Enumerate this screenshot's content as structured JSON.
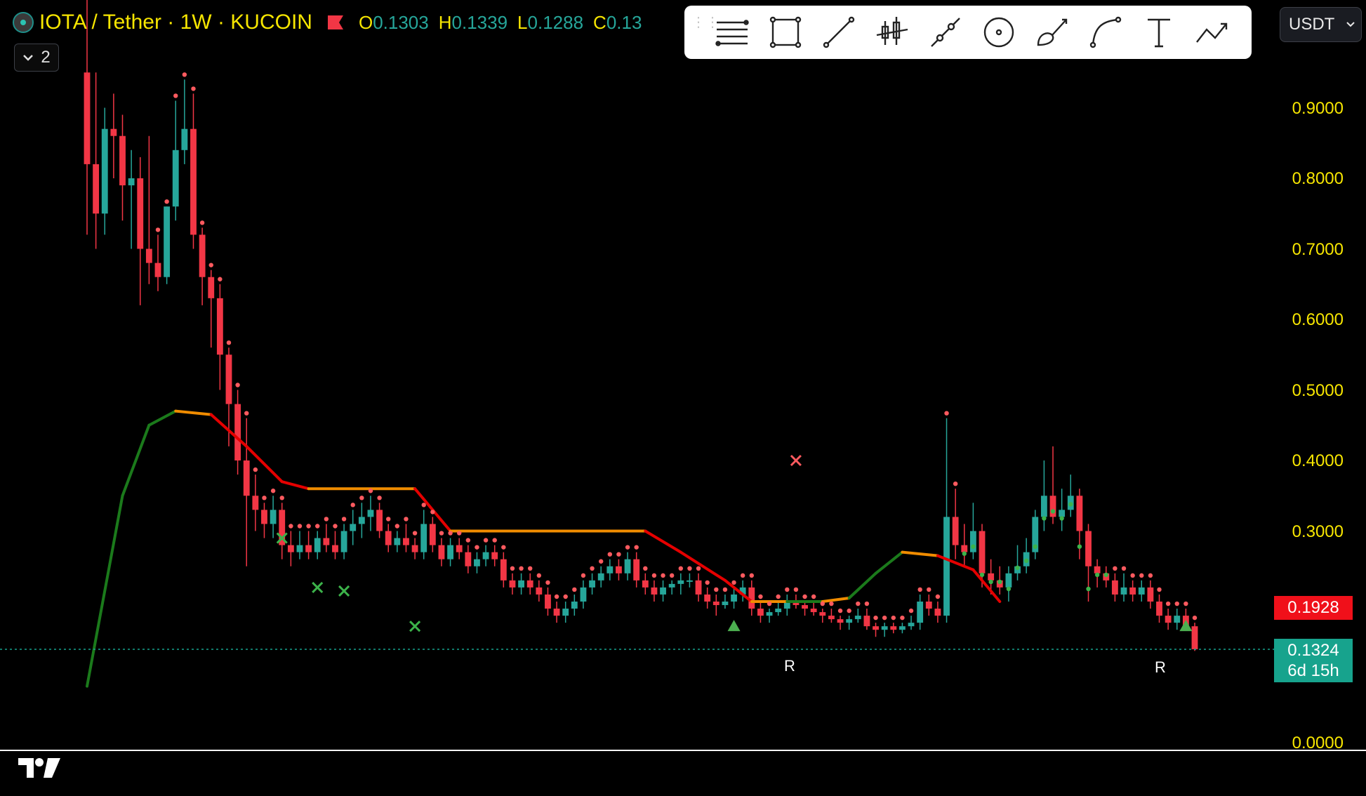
{
  "header": {
    "symbol_title": "IOTA / Tether · 1W · KUCOIN",
    "ohlc": [
      {
        "key": "O",
        "value": "0.1303"
      },
      {
        "key": "H",
        "value": "0.1339"
      },
      {
        "key": "L",
        "value": "0.1288"
      },
      {
        "key": "C",
        "value": "0.13"
      }
    ],
    "collapse_count": "2",
    "currency": "USDT"
  },
  "toolbar": {
    "tools": [
      "lines-menu-icon",
      "rectangle-icon",
      "trend-line-icon",
      "candles-icon",
      "segment-icon",
      "circle-icon",
      "brush-icon",
      "curve-icon",
      "text-icon",
      "path-icon"
    ]
  },
  "colors": {
    "up": "#26a69a",
    "down": "#f23645",
    "axis_text": "#f7e600",
    "line_green": "#1b7a1b",
    "line_red": "#e50000",
    "line_orange": "#f08c00"
  },
  "price_labels": {
    "current_line_value": "0.1928",
    "last_price": "0.1324",
    "countdown": "6d 15h"
  },
  "markers": {
    "r_label": "R"
  },
  "chart_data": {
    "type": "candlestick",
    "title": "IOTA / Tether · 1W · KUCOIN",
    "y_ticks": [
      "0.0000",
      "0.3000",
      "0.4000",
      "0.5000",
      "0.6000",
      "0.7000",
      "0.8000",
      "0.9000"
    ],
    "y_tick_values": [
      0.0,
      0.3,
      0.4,
      0.5,
      0.6,
      0.7,
      0.8,
      0.9
    ],
    "ylim": [
      0.0,
      1.0
    ],
    "candles": [
      [
        0.95,
        1.1,
        0.72,
        0.82
      ],
      [
        0.82,
        0.95,
        0.7,
        0.75
      ],
      [
        0.75,
        0.9,
        0.72,
        0.87
      ],
      [
        0.87,
        0.92,
        0.8,
        0.86
      ],
      [
        0.86,
        0.89,
        0.74,
        0.79
      ],
      [
        0.79,
        0.84,
        0.7,
        0.8
      ],
      [
        0.8,
        0.83,
        0.62,
        0.7
      ],
      [
        0.7,
        0.86,
        0.65,
        0.68
      ],
      [
        0.68,
        0.72,
        0.64,
        0.66
      ],
      [
        0.66,
        0.76,
        0.65,
        0.76
      ],
      [
        0.76,
        0.91,
        0.74,
        0.84
      ],
      [
        0.84,
        0.94,
        0.82,
        0.87
      ],
      [
        0.87,
        0.92,
        0.7,
        0.72
      ],
      [
        0.72,
        0.73,
        0.62,
        0.66
      ],
      [
        0.66,
        0.67,
        0.56,
        0.63
      ],
      [
        0.63,
        0.65,
        0.5,
        0.55
      ],
      [
        0.55,
        0.56,
        0.42,
        0.48
      ],
      [
        0.48,
        0.5,
        0.38,
        0.4
      ],
      [
        0.4,
        0.46,
        0.25,
        0.35
      ],
      [
        0.35,
        0.38,
        0.3,
        0.33
      ],
      [
        0.33,
        0.34,
        0.29,
        0.31
      ],
      [
        0.31,
        0.35,
        0.29,
        0.33
      ],
      [
        0.33,
        0.34,
        0.26,
        0.28
      ],
      [
        0.28,
        0.3,
        0.25,
        0.27
      ],
      [
        0.27,
        0.3,
        0.26,
        0.28
      ],
      [
        0.28,
        0.3,
        0.26,
        0.27
      ],
      [
        0.27,
        0.3,
        0.26,
        0.29
      ],
      [
        0.29,
        0.31,
        0.27,
        0.28
      ],
      [
        0.28,
        0.3,
        0.26,
        0.27
      ],
      [
        0.27,
        0.31,
        0.26,
        0.3
      ],
      [
        0.3,
        0.33,
        0.28,
        0.31
      ],
      [
        0.31,
        0.34,
        0.29,
        0.32
      ],
      [
        0.32,
        0.35,
        0.3,
        0.33
      ],
      [
        0.33,
        0.34,
        0.29,
        0.3
      ],
      [
        0.3,
        0.31,
        0.27,
        0.28
      ],
      [
        0.28,
        0.3,
        0.27,
        0.29
      ],
      [
        0.29,
        0.31,
        0.27,
        0.28
      ],
      [
        0.28,
        0.29,
        0.26,
        0.27
      ],
      [
        0.27,
        0.33,
        0.26,
        0.31
      ],
      [
        0.31,
        0.32,
        0.27,
        0.28
      ],
      [
        0.28,
        0.29,
        0.25,
        0.26
      ],
      [
        0.26,
        0.29,
        0.25,
        0.28
      ],
      [
        0.28,
        0.29,
        0.26,
        0.27
      ],
      [
        0.27,
        0.28,
        0.24,
        0.25
      ],
      [
        0.25,
        0.27,
        0.24,
        0.26
      ],
      [
        0.26,
        0.28,
        0.25,
        0.27
      ],
      [
        0.27,
        0.28,
        0.25,
        0.26
      ],
      [
        0.26,
        0.27,
        0.22,
        0.23
      ],
      [
        0.23,
        0.24,
        0.21,
        0.22
      ],
      [
        0.22,
        0.24,
        0.21,
        0.23
      ],
      [
        0.23,
        0.24,
        0.21,
        0.22
      ],
      [
        0.22,
        0.23,
        0.2,
        0.21
      ],
      [
        0.21,
        0.22,
        0.18,
        0.19
      ],
      [
        0.19,
        0.2,
        0.17,
        0.18
      ],
      [
        0.18,
        0.2,
        0.17,
        0.19
      ],
      [
        0.19,
        0.21,
        0.18,
        0.2
      ],
      [
        0.2,
        0.23,
        0.19,
        0.22
      ],
      [
        0.22,
        0.24,
        0.21,
        0.23
      ],
      [
        0.23,
        0.25,
        0.22,
        0.24
      ],
      [
        0.24,
        0.26,
        0.23,
        0.25
      ],
      [
        0.25,
        0.26,
        0.23,
        0.24
      ],
      [
        0.24,
        0.27,
        0.23,
        0.26
      ],
      [
        0.26,
        0.27,
        0.22,
        0.23
      ],
      [
        0.23,
        0.24,
        0.21,
        0.22
      ],
      [
        0.22,
        0.23,
        0.2,
        0.21
      ],
      [
        0.21,
        0.23,
        0.2,
        0.22
      ],
      [
        0.22,
        0.23,
        0.21,
        0.225
      ],
      [
        0.225,
        0.24,
        0.21,
        0.23
      ],
      [
        0.23,
        0.24,
        0.22,
        0.23
      ],
      [
        0.23,
        0.24,
        0.2,
        0.21
      ],
      [
        0.21,
        0.22,
        0.19,
        0.2
      ],
      [
        0.2,
        0.21,
        0.18,
        0.195
      ],
      [
        0.195,
        0.21,
        0.19,
        0.2
      ],
      [
        0.2,
        0.22,
        0.19,
        0.21
      ],
      [
        0.21,
        0.23,
        0.2,
        0.22
      ],
      [
        0.22,
        0.23,
        0.18,
        0.19
      ],
      [
        0.19,
        0.2,
        0.17,
        0.18
      ],
      [
        0.18,
        0.19,
        0.17,
        0.185
      ],
      [
        0.185,
        0.2,
        0.18,
        0.19
      ],
      [
        0.19,
        0.21,
        0.18,
        0.2
      ],
      [
        0.2,
        0.21,
        0.19,
        0.195
      ],
      [
        0.195,
        0.2,
        0.18,
        0.19
      ],
      [
        0.19,
        0.2,
        0.18,
        0.185
      ],
      [
        0.185,
        0.19,
        0.17,
        0.18
      ],
      [
        0.18,
        0.19,
        0.17,
        0.175
      ],
      [
        0.175,
        0.18,
        0.16,
        0.17
      ],
      [
        0.17,
        0.18,
        0.16,
        0.175
      ],
      [
        0.175,
        0.19,
        0.17,
        0.18
      ],
      [
        0.18,
        0.19,
        0.16,
        0.165
      ],
      [
        0.165,
        0.17,
        0.15,
        0.16
      ],
      [
        0.16,
        0.17,
        0.15,
        0.165
      ],
      [
        0.165,
        0.17,
        0.155,
        0.16
      ],
      [
        0.16,
        0.17,
        0.155,
        0.165
      ],
      [
        0.165,
        0.18,
        0.16,
        0.17
      ],
      [
        0.17,
        0.21,
        0.16,
        0.2
      ],
      [
        0.2,
        0.21,
        0.18,
        0.19
      ],
      [
        0.19,
        0.2,
        0.17,
        0.18
      ],
      [
        0.18,
        0.46,
        0.17,
        0.32
      ],
      [
        0.32,
        0.36,
        0.26,
        0.28
      ],
      [
        0.28,
        0.31,
        0.25,
        0.27
      ],
      [
        0.27,
        0.34,
        0.26,
        0.3
      ],
      [
        0.3,
        0.31,
        0.22,
        0.24
      ],
      [
        0.24,
        0.26,
        0.21,
        0.23
      ],
      [
        0.23,
        0.25,
        0.21,
        0.22
      ],
      [
        0.22,
        0.25,
        0.2,
        0.24
      ],
      [
        0.24,
        0.28,
        0.23,
        0.25
      ],
      [
        0.25,
        0.29,
        0.24,
        0.27
      ],
      [
        0.27,
        0.33,
        0.26,
        0.32
      ],
      [
        0.32,
        0.4,
        0.3,
        0.35
      ],
      [
        0.35,
        0.42,
        0.31,
        0.32
      ],
      [
        0.32,
        0.36,
        0.3,
        0.33
      ],
      [
        0.33,
        0.38,
        0.32,
        0.35
      ],
      [
        0.35,
        0.36,
        0.26,
        0.3
      ],
      [
        0.3,
        0.31,
        0.2,
        0.25
      ],
      [
        0.25,
        0.26,
        0.22,
        0.24
      ],
      [
        0.24,
        0.25,
        0.22,
        0.23
      ],
      [
        0.23,
        0.24,
        0.2,
        0.21
      ],
      [
        0.21,
        0.24,
        0.2,
        0.22
      ],
      [
        0.22,
        0.23,
        0.2,
        0.21
      ],
      [
        0.21,
        0.23,
        0.2,
        0.22
      ],
      [
        0.22,
        0.23,
        0.19,
        0.2
      ],
      [
        0.2,
        0.21,
        0.17,
        0.18
      ],
      [
        0.18,
        0.19,
        0.16,
        0.17
      ],
      [
        0.17,
        0.19,
        0.16,
        0.18
      ],
      [
        0.18,
        0.19,
        0.16,
        0.165
      ],
      [
        0.165,
        0.17,
        0.13,
        0.1324
      ]
    ],
    "overlay_line": [
      {
        "i": 0,
        "y": 0.08,
        "c": "green"
      },
      {
        "i": 4,
        "y": 0.35,
        "c": "green"
      },
      {
        "i": 7,
        "y": 0.45,
        "c": "green"
      },
      {
        "i": 10,
        "y": 0.47,
        "c": "orange"
      },
      {
        "i": 14,
        "y": 0.465,
        "c": "red"
      },
      {
        "i": 18,
        "y": 0.42,
        "c": "red"
      },
      {
        "i": 22,
        "y": 0.37,
        "c": "red"
      },
      {
        "i": 25,
        "y": 0.36,
        "c": "orange"
      },
      {
        "i": 37,
        "y": 0.36,
        "c": "red"
      },
      {
        "i": 41,
        "y": 0.3,
        "c": "orange"
      },
      {
        "i": 63,
        "y": 0.3,
        "c": "red"
      },
      {
        "i": 67,
        "y": 0.27,
        "c": "red"
      },
      {
        "i": 72,
        "y": 0.23,
        "c": "red"
      },
      {
        "i": 75,
        "y": 0.2,
        "c": "orange"
      },
      {
        "i": 79,
        "y": 0.2,
        "c": "green"
      },
      {
        "i": 83,
        "y": 0.2,
        "c": "orange"
      },
      {
        "i": 86,
        "y": 0.205,
        "c": "green"
      },
      {
        "i": 89,
        "y": 0.24,
        "c": "green"
      },
      {
        "i": 92,
        "y": 0.27,
        "c": "orange"
      },
      {
        "i": 96,
        "y": 0.265,
        "c": "red"
      },
      {
        "i": 100,
        "y": 0.245,
        "c": "red"
      },
      {
        "i": 103,
        "y": 0.2,
        "c": "red"
      }
    ],
    "cross_markers": [
      {
        "i": 22,
        "y": 0.29,
        "c": "green"
      },
      {
        "i": 26,
        "y": 0.22,
        "c": "green"
      },
      {
        "i": 29,
        "y": 0.215,
        "c": "green"
      },
      {
        "i": 37,
        "y": 0.165,
        "c": "green"
      },
      {
        "i": 80,
        "y": 0.4,
        "c": "red"
      }
    ],
    "triangle_markers": [
      {
        "i": 73,
        "y": 0.165
      },
      {
        "i": 124,
        "y": 0.165
      }
    ]
  }
}
